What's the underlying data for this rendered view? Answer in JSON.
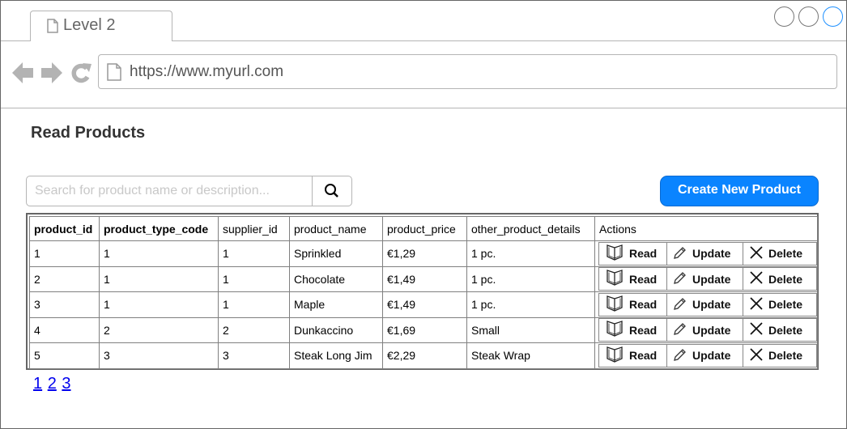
{
  "browser": {
    "tab_title": "Level 2",
    "url": "https://www.myurl.com"
  },
  "page": {
    "title": "Read Products",
    "search_placeholder": "Search for product name or description...",
    "create_button": "Create New Product"
  },
  "table": {
    "headers": [
      "product_id",
      "product_type_code",
      "supplier_id",
      "product_name",
      "product_price",
      "other_product_details",
      "Actions"
    ],
    "rows": [
      [
        "1",
        "1",
        "1",
        "Sprinkled",
        "€1,29",
        "1 pc."
      ],
      [
        "2",
        "1",
        "1",
        "Chocolate",
        "€1,49",
        "1 pc."
      ],
      [
        "3",
        "1",
        "1",
        "Maple",
        "€1,49",
        "1 pc."
      ],
      [
        "4",
        "2",
        "2",
        "Dunkaccino",
        "€1,69",
        "Small"
      ],
      [
        "5",
        "3",
        "3",
        "Steak Long Jim",
        "€2,29",
        "Steak Wrap"
      ]
    ],
    "actions": {
      "read": "Read",
      "update": "Update",
      "delete": "Delete"
    }
  },
  "pagination": [
    "1",
    "2",
    "3"
  ],
  "colors": {
    "accent": "#0a84ff",
    "link": "#0000ee"
  }
}
